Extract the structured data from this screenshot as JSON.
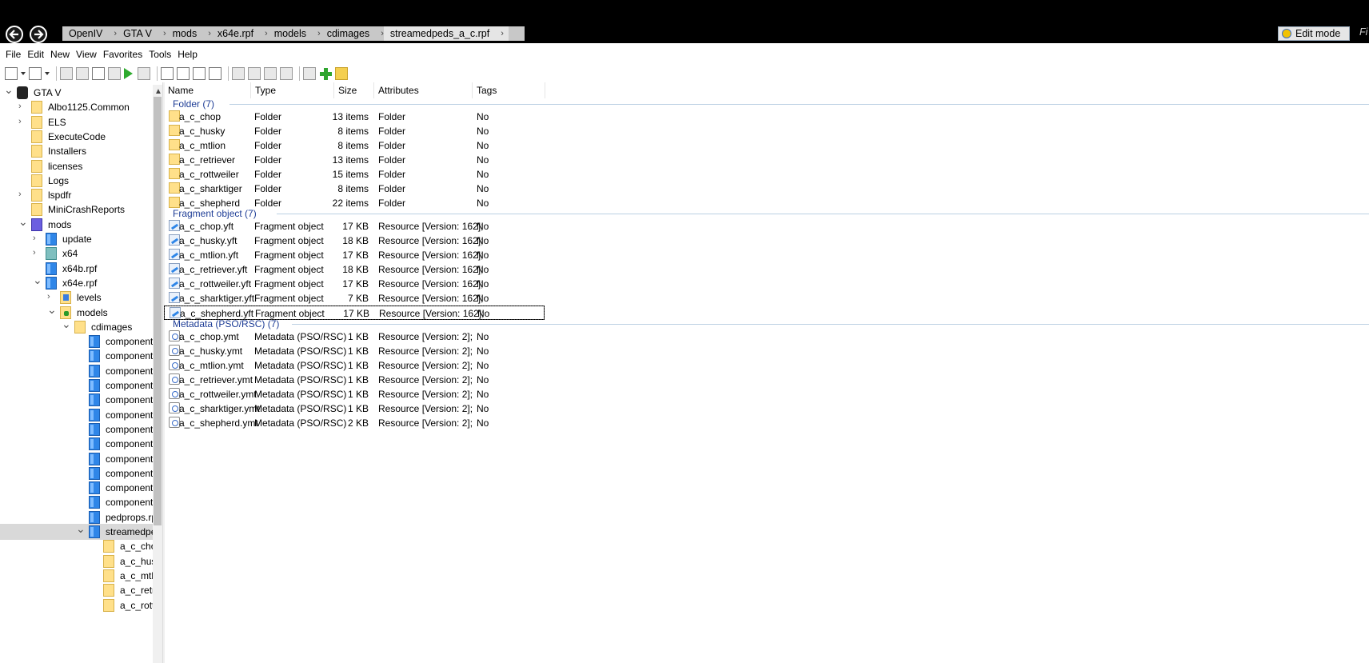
{
  "breadcrumb": [
    "OpenIV",
    "GTA V",
    "mods",
    "x64e.rpf",
    "models",
    "cdimages",
    "streamedpeds_a_c.rpf"
  ],
  "edit_mode_label": "Edit mode",
  "cut_text": "Fi",
  "menu": [
    "File",
    "Edit",
    "New",
    "View",
    "Favorites",
    "Tools",
    "Help"
  ],
  "tree": [
    {
      "label": "GTA V",
      "icon": "gta-icon",
      "expanded": true
    },
    {
      "label": "Albo1125.Common",
      "icon": "folder-icon",
      "expandable": true
    },
    {
      "label": "ELS",
      "icon": "folder-icon",
      "expandable": true
    },
    {
      "label": "ExecuteCode",
      "icon": "folder-icon"
    },
    {
      "label": "Installers",
      "icon": "folder-icon"
    },
    {
      "label": "licenses",
      "icon": "folder-icon"
    },
    {
      "label": "Logs",
      "icon": "folder-icon"
    },
    {
      "label": "lspdfr",
      "icon": "folder-icon",
      "expandable": true
    },
    {
      "label": "MiniCrashReports",
      "icon": "folder-icon"
    },
    {
      "label": "mods",
      "icon": "mods-icon",
      "expanded": true
    },
    {
      "label": "update",
      "icon": "rpf-icon",
      "expandable": true
    },
    {
      "label": "x64",
      "icon": "teal-folder-icon",
      "expandable": true
    },
    {
      "label": "x64b.rpf",
      "icon": "rpf-icon"
    },
    {
      "label": "x64e.rpf",
      "icon": "rpf-icon",
      "expanded": true
    },
    {
      "label": "levels",
      "icon": "levels-icon",
      "expandable": true
    },
    {
      "label": "models",
      "icon": "models-icon",
      "expanded": true
    },
    {
      "label": "cdimages",
      "icon": "folder-icon",
      "expanded": true
    },
    {
      "label": "componentpe",
      "icon": "rpf-icon"
    },
    {
      "label": "componentpe",
      "icon": "rpf-icon"
    },
    {
      "label": "componentpe",
      "icon": "rpf-icon"
    },
    {
      "label": "componentpe",
      "icon": "rpf-icon"
    },
    {
      "label": "componentpe",
      "icon": "rpf-icon"
    },
    {
      "label": "componentpe",
      "icon": "rpf-icon"
    },
    {
      "label": "componentpe",
      "icon": "rpf-icon"
    },
    {
      "label": "componentpe",
      "icon": "rpf-icon"
    },
    {
      "label": "componentpe",
      "icon": "rpf-icon"
    },
    {
      "label": "componentpe",
      "icon": "rpf-icon"
    },
    {
      "label": "componentpe",
      "icon": "rpf-icon"
    },
    {
      "label": "componentpe",
      "icon": "rpf-icon"
    },
    {
      "label": "pedprops.rpf",
      "icon": "rpf-icon"
    },
    {
      "label": "streamedpeds",
      "icon": "rpf-icon",
      "expanded": true,
      "selected": true
    },
    {
      "label": "a_c_chop",
      "icon": "folder-icon"
    },
    {
      "label": "a_c_husky",
      "icon": "folder-icon"
    },
    {
      "label": "a_c_mtlion",
      "icon": "folder-icon"
    },
    {
      "label": "a_c_retrie",
      "icon": "folder-icon"
    },
    {
      "label": "a_c_rottw",
      "icon": "folder-icon"
    }
  ],
  "columns": [
    "Name",
    "Type",
    "Size",
    "Attributes",
    "Tags"
  ],
  "groups": [
    {
      "title": "Folder (7)",
      "icon": "folder-icon",
      "items": [
        {
          "name": "a_c_chop",
          "type": "Folder",
          "size": "13 items",
          "attributes": "Folder",
          "tags": "No"
        },
        {
          "name": "a_c_husky",
          "type": "Folder",
          "size": "8 items",
          "attributes": "Folder",
          "tags": "No"
        },
        {
          "name": "a_c_mtlion",
          "type": "Folder",
          "size": "8 items",
          "attributes": "Folder",
          "tags": "No"
        },
        {
          "name": "a_c_retriever",
          "type": "Folder",
          "size": "13 items",
          "attributes": "Folder",
          "tags": "No"
        },
        {
          "name": "a_c_rottweiler",
          "type": "Folder",
          "size": "15 items",
          "attributes": "Folder",
          "tags": "No"
        },
        {
          "name": "a_c_sharktiger",
          "type": "Folder",
          "size": "8 items",
          "attributes": "Folder",
          "tags": "No"
        },
        {
          "name": "a_c_shepherd",
          "type": "Folder",
          "size": "22 items",
          "attributes": "Folder",
          "tags": "No"
        }
      ]
    },
    {
      "title": "Fragment object (7)",
      "icon": "fragment-icon",
      "items": [
        {
          "name": "a_c_chop.yft",
          "type": "Fragment object",
          "size": "17 KB",
          "attributes": "Resource [Version: 162];",
          "tags": "No"
        },
        {
          "name": "a_c_husky.yft",
          "type": "Fragment object",
          "size": "18 KB",
          "attributes": "Resource [Version: 162];",
          "tags": "No"
        },
        {
          "name": "a_c_mtlion.yft",
          "type": "Fragment object",
          "size": "17 KB",
          "attributes": "Resource [Version: 162];",
          "tags": "No"
        },
        {
          "name": "a_c_retriever.yft",
          "type": "Fragment object",
          "size": "18 KB",
          "attributes": "Resource [Version: 162];",
          "tags": "No"
        },
        {
          "name": "a_c_rottweiler.yft",
          "type": "Fragment object",
          "size": "17 KB",
          "attributes": "Resource [Version: 162];",
          "tags": "No"
        },
        {
          "name": "a_c_sharktiger.yft",
          "type": "Fragment object",
          "size": "7 KB",
          "attributes": "Resource [Version: 162];",
          "tags": "No"
        },
        {
          "name": "a_c_shepherd.yft",
          "type": "Fragment object",
          "size": "17 KB",
          "attributes": "Resource [Version: 162];",
          "tags": "No",
          "focused": true
        }
      ]
    },
    {
      "title": "Metadata (PSO/RSC) (7)",
      "icon": "metadata-icon",
      "items": [
        {
          "name": "a_c_chop.ymt",
          "type": "Metadata (PSO/RSC)",
          "size": "1 KB",
          "attributes": "Resource [Version: 2];",
          "tags": "No"
        },
        {
          "name": "a_c_husky.ymt",
          "type": "Metadata (PSO/RSC)",
          "size": "1 KB",
          "attributes": "Resource [Version: 2];",
          "tags": "No"
        },
        {
          "name": "a_c_mtlion.ymt",
          "type": "Metadata (PSO/RSC)",
          "size": "1 KB",
          "attributes": "Resource [Version: 2];",
          "tags": "No"
        },
        {
          "name": "a_c_retriever.ymt",
          "type": "Metadata (PSO/RSC)",
          "size": "1 KB",
          "attributes": "Resource [Version: 2];",
          "tags": "No"
        },
        {
          "name": "a_c_rottweiler.ymt",
          "type": "Metadata (PSO/RSC)",
          "size": "1 KB",
          "attributes": "Resource [Version: 2];",
          "tags": "No"
        },
        {
          "name": "a_c_sharktiger.ymt",
          "type": "Metadata (PSO/RSC)",
          "size": "1 KB",
          "attributes": "Resource [Version: 2];",
          "tags": "No"
        },
        {
          "name": "a_c_shepherd.ymt",
          "type": "Metadata (PSO/RSC)",
          "size": "2 KB",
          "attributes": "Resource [Version: 2];",
          "tags": "No"
        }
      ]
    }
  ],
  "colors": {
    "group_title": "#1e3d96",
    "selection": "#d9d9d9",
    "folder": "#ffe08a",
    "rpf": "#2f86e8"
  }
}
